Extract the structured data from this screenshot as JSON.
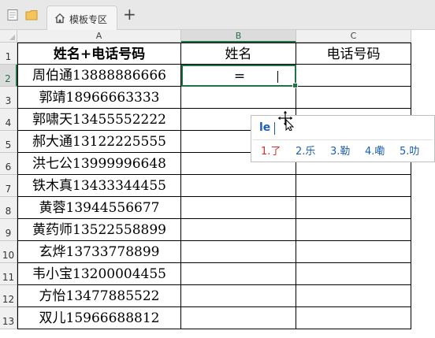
{
  "tabs": {
    "template_tab_label": "模板专区",
    "add_tab_symbol": "+"
  },
  "columns": [
    "A",
    "B",
    "C"
  ],
  "rows": [
    "1",
    "2",
    "3",
    "4",
    "5",
    "6",
    "7",
    "8",
    "9",
    "10",
    "11",
    "12",
    "13"
  ],
  "header_row": {
    "a": "姓名+电话号码",
    "b": "姓名",
    "c": "电话号码"
  },
  "data_rows": [
    "周伯通13888886666",
    "郭靖18966663333",
    "郭啸天13455552222",
    "郝大通13122225555",
    "洪七公13999996648",
    "铁木真13433344455",
    "黄蓉13944556677",
    "黄药师13522558899",
    "玄烨13733778899",
    "韦小宝13200004455",
    "方怡13477885522",
    "双儿15966688812"
  ],
  "editing_cell": {
    "text": "="
  },
  "ime": {
    "pinyin": "le",
    "candidates": [
      "1.了",
      "2.乐",
      "3.勒",
      "4.嘞",
      "5.叻"
    ]
  },
  "colors": {
    "selection": "#217346",
    "ime_text": "#1a5fb4",
    "ime_first": "#d32f2f"
  }
}
